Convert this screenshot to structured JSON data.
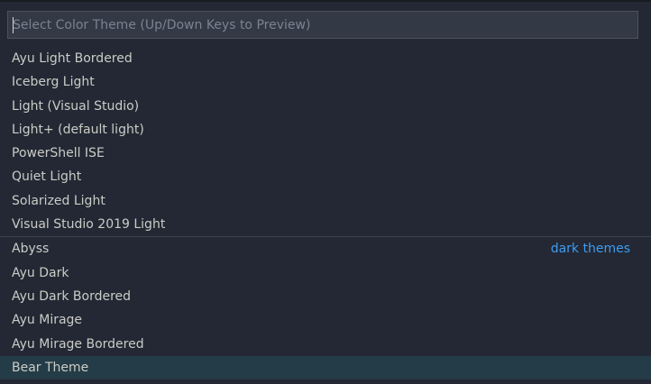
{
  "search": {
    "placeholder": "Select Color Theme (Up/Down Keys to Preview)",
    "value": ""
  },
  "items": [
    {
      "label": "Ayu Light Bordered"
    },
    {
      "label": "Iceberg Light"
    },
    {
      "label": "Light (Visual Studio)"
    },
    {
      "label": "Light+ (default light)"
    },
    {
      "label": "PowerShell ISE"
    },
    {
      "label": "Quiet Light"
    },
    {
      "label": "Solarized Light"
    },
    {
      "label": "Visual Studio 2019 Light"
    },
    {
      "label": "Abyss",
      "group": "dark themes"
    },
    {
      "label": "Ayu Dark"
    },
    {
      "label": "Ayu Dark Bordered"
    },
    {
      "label": "Ayu Mirage"
    },
    {
      "label": "Ayu Mirage Bordered"
    },
    {
      "label": "Bear Theme"
    }
  ],
  "colors": {
    "background": "#232834",
    "selected": "#243c47",
    "group_label": "#3f9cf0",
    "text": "#cbccc6"
  }
}
